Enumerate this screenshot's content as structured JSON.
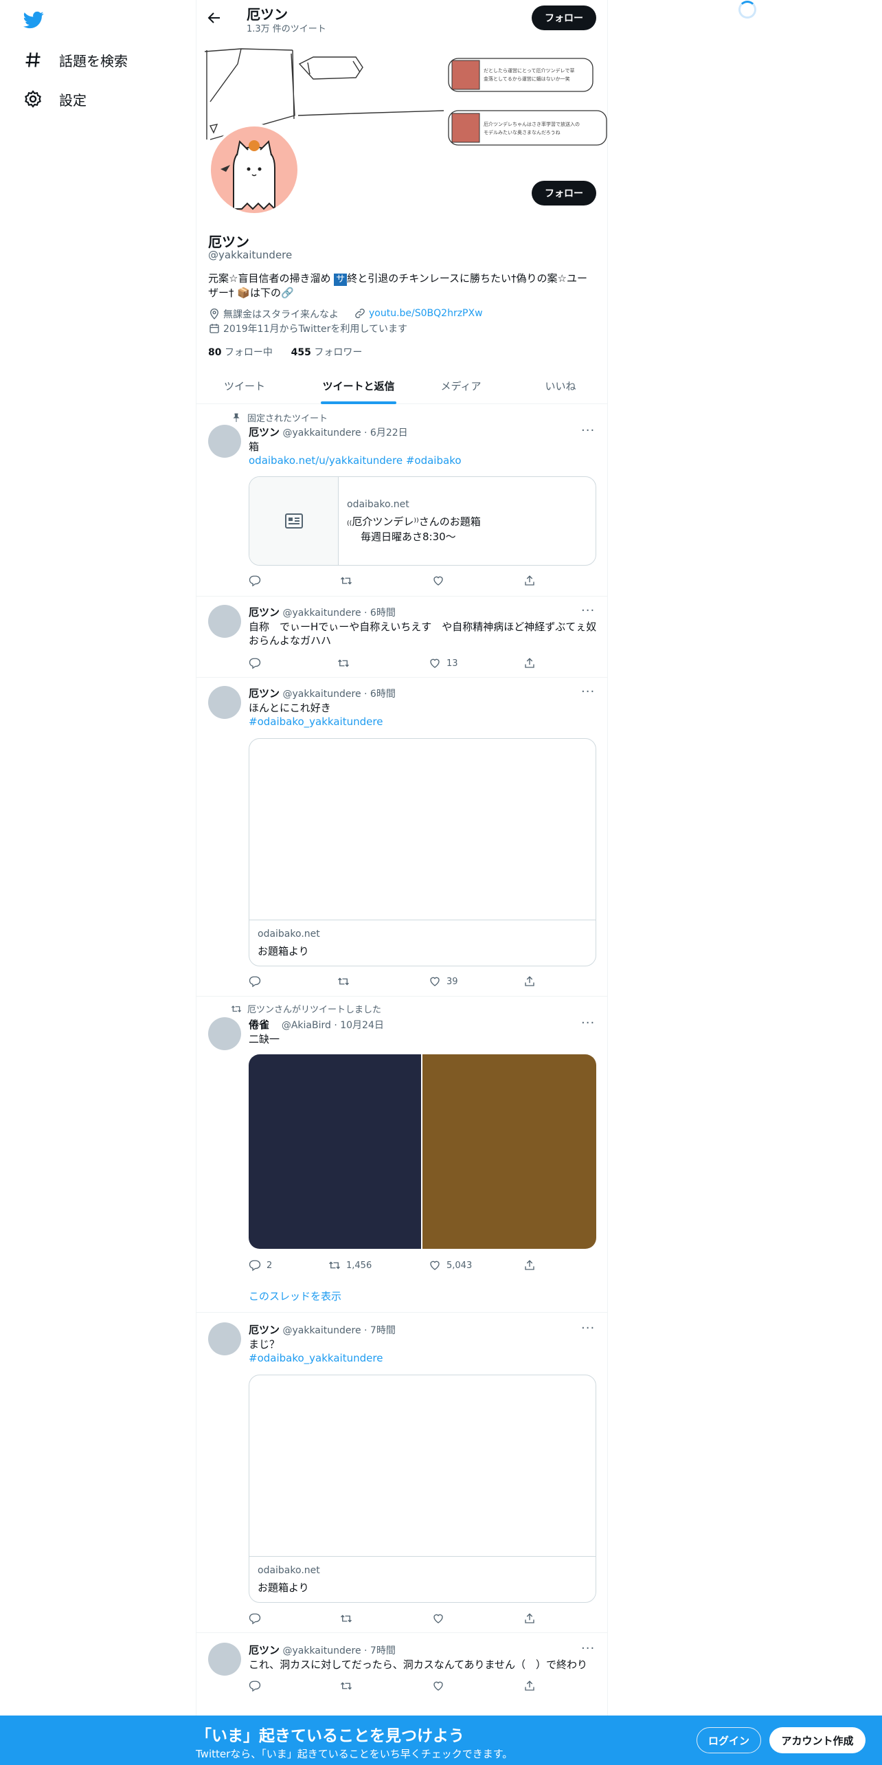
{
  "nav": {
    "logo_icon": "twitter-bird-icon",
    "explore_label": "話題を検索",
    "settings_label": "設定"
  },
  "header": {
    "name": "厄ツン",
    "tweet_count": "1.3万 件のツイート",
    "follow_label": "フォロー"
  },
  "profile": {
    "name": "厄ツン",
    "handle": "@yakkaitundere",
    "bio_before": "元案☆盲目信者の掃き溜め ",
    "bio_box": "サ",
    "bio_after": "終と引退のチキンレースに勝ちたい†偽りの案☆ユーザー† 📦は下の🔗",
    "location": "無課金はスタライ来んなよ",
    "link": "youtu.be/S0BQ2hrzPXw",
    "joined": "2019年11月からTwitterを利用しています",
    "following_count": "80",
    "following_label": "フォロー中",
    "followers_count": "455",
    "followers_label": "フォロワー",
    "follow_label": "フォロー",
    "banner_note_1": "だとしたら運営にとって厄介ツンデレで草\n金落としてるから運営に媚はないか一笑",
    "banner_note_2": "厄介ツンデレちゃんはさき率学習で放送入の\nモデルみたいな奥さまなんだろうね"
  },
  "tabs": [
    "ツイート",
    "ツイートと返信",
    "メディア",
    "いいね"
  ],
  "tweets": [
    {
      "pinned_label": "固定されたツイート",
      "name": "厄ツン",
      "meta": "@yakkaitundere · 6月22日",
      "text": "箱",
      "link": "odaibako.net/u/yakkaitundere #odaibako",
      "card_domain": "odaibako.net",
      "card_title": "₍₍厄介ツンデレ⁾⁾さんのお題箱",
      "card_desc": "毎週日曜あさ8:30〜",
      "likes": ""
    },
    {
      "name": "厄ツン",
      "meta": "@yakkaitundere · 6時間",
      "text": "自称　でぃーHでぃーや自称えいちえす　や自称精神病ほど神経ずぶてぇ奴おらんよなガハハ",
      "likes": "13"
    },
    {
      "name": "厄ツン",
      "meta": "@yakkaitundere · 6時間",
      "text": "ほんとにこれ好き",
      "link": "#odaibako_yakkaitundere",
      "card_domain": "odaibako.net",
      "card_title": "お題箱より",
      "likes": "39"
    },
    {
      "rt_label": "厄ツンさんがリツイートしました",
      "name": "倦雀",
      "meta": "@AkiaBird · 10月24日",
      "text": "二缺一",
      "replies": "2",
      "retweets": "1,456",
      "likes": "5,043",
      "show_thread": "このスレッドを表示"
    },
    {
      "name": "厄ツン",
      "meta": "@yakkaitundere · 7時間",
      "text": "まじ？",
      "link": "#odaibako_yakkaitundere",
      "card_domain": "odaibako.net",
      "card_title": "お題箱より"
    },
    {
      "name": "厄ツン",
      "meta": "@yakkaitundere · 7時間",
      "text": "これ、洞カスに対してだったら、洞カスなんてありません（　）で終わり"
    }
  ],
  "bottom": {
    "title": "「いま」起きていることを見つけよう",
    "subtitle": "Twitterなら、「いま」起きていることをいち早くチェックできます。",
    "login": "ログイン",
    "signup": "アカウント作成"
  },
  "colors": {
    "accent": "#1d9bf0",
    "text": "#0f1419",
    "secondary": "#536471",
    "avatar_bg": "#f9b7a8",
    "image_left": "#222840",
    "image_right": "#7f5a24"
  }
}
